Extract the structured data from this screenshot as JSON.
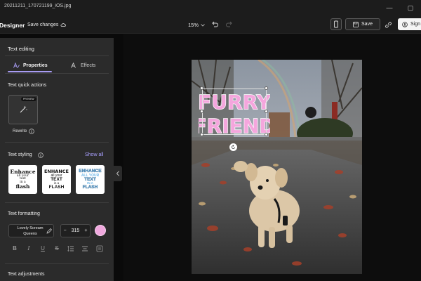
{
  "titlebar": {
    "title": "20211211_170721199_iOS.jpg"
  },
  "toolbar": {
    "brand": "Designer",
    "save_changes_label": "Save changes",
    "zoom_label": "15%",
    "save_label": "Save",
    "sign_label": "Sign"
  },
  "panel": {
    "title": "Text editing",
    "tabs": [
      {
        "label": "Properties",
        "active": true
      },
      {
        "label": "Effects",
        "active": false
      }
    ],
    "quick_actions": {
      "heading": "Text quick actions",
      "badge": "PREVIEW",
      "rewrite_label": "Rewrite"
    },
    "styling": {
      "heading": "Text styling",
      "show_all": "Show all",
      "cards": [
        {
          "lines": [
            "Enhance",
            "all your",
            "text",
            "in a",
            "flash"
          ]
        },
        {
          "lines": [
            "ENHANCE",
            "all your",
            "TEXT",
            "in a",
            "FLASH"
          ]
        },
        {
          "lines": [
            "ENHANCE",
            "ALL YOUR",
            "TEXT",
            "IN A",
            "FLASH"
          ]
        }
      ]
    },
    "formatting": {
      "heading": "Text formatting",
      "font_name": "Lovely Scream Queens",
      "font_size": "315",
      "minus": "−",
      "plus": "+",
      "swatch_color": "#f0a8de"
    },
    "adjustments_heading": "Text adjustments"
  },
  "canvas": {
    "overlay_text_line1": "FURRY",
    "overlay_text_line2": "FRIEND",
    "overlay_fill": "#f4a6dd",
    "overlay_outline": "#ffffff"
  },
  "colors": {
    "accent": "#a79bf2",
    "panel_bg": "#2b2b2b",
    "toolbar_bg": "#1c1c1c"
  }
}
